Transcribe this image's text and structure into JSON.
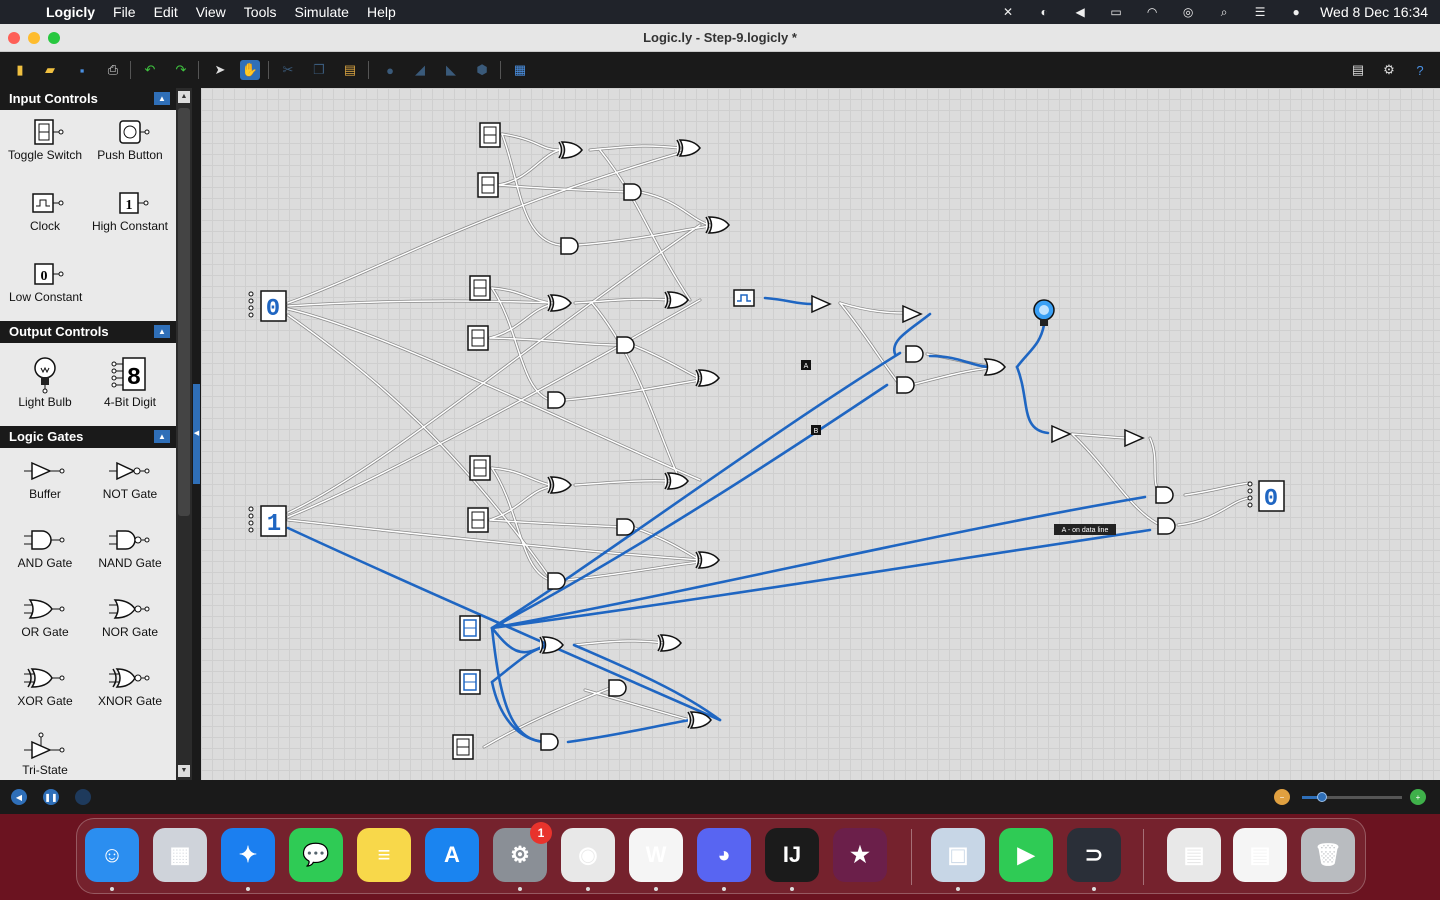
{
  "menubar": {
    "app_name": "Logicly",
    "items": [
      "File",
      "Edit",
      "View",
      "Tools",
      "Simulate",
      "Help"
    ],
    "clock": "Wed 8 Dec  16:34"
  },
  "window": {
    "title": "Logic.ly - Step-9.logicly *"
  },
  "palette": {
    "sections": [
      {
        "title": "Input Controls",
        "items": [
          {
            "label": "Toggle Switch",
            "icon": "toggle-switch-icon"
          },
          {
            "label": "Push Button",
            "icon": "push-button-icon"
          },
          {
            "label": "Clock",
            "icon": "clock-icon"
          },
          {
            "label": "High Constant",
            "icon": "high-constant-icon",
            "glyph": "1"
          },
          {
            "label": "Low Constant",
            "icon": "low-constant-icon",
            "glyph": "0"
          }
        ]
      },
      {
        "title": "Output Controls",
        "items": [
          {
            "label": "Light Bulb",
            "icon": "light-bulb-icon"
          },
          {
            "label": "4-Bit Digit",
            "icon": "four-bit-digit-icon",
            "glyph": "8"
          }
        ]
      },
      {
        "title": "Logic Gates",
        "items": [
          {
            "label": "Buffer",
            "icon": "buffer-gate-icon"
          },
          {
            "label": "NOT Gate",
            "icon": "not-gate-icon"
          },
          {
            "label": "AND Gate",
            "icon": "and-gate-icon"
          },
          {
            "label": "NAND Gate",
            "icon": "nand-gate-icon"
          },
          {
            "label": "OR Gate",
            "icon": "or-gate-icon"
          },
          {
            "label": "NOR Gate",
            "icon": "nor-gate-icon"
          },
          {
            "label": "XOR Gate",
            "icon": "xor-gate-icon"
          },
          {
            "label": "XNOR Gate",
            "icon": "xnor-gate-icon"
          },
          {
            "label": "Tri-State",
            "icon": "tri-state-icon"
          }
        ]
      }
    ]
  },
  "canvas": {
    "digit_left_top": "0",
    "digit_left_bottom": "1",
    "digit_right": "0",
    "label_a": "A",
    "label_b": "B",
    "tooltip": "A - on data line"
  },
  "dock": {
    "apps": [
      {
        "name": "Finder",
        "icon": "finder-icon",
        "color": "#2b8ef0",
        "glyph": "☺",
        "running": true
      },
      {
        "name": "Launchpad",
        "icon": "launchpad-icon",
        "color": "#cfd3da",
        "glyph": "▦",
        "running": false
      },
      {
        "name": "Safari",
        "icon": "safari-icon",
        "color": "#1b7ff0",
        "glyph": "✦",
        "running": true
      },
      {
        "name": "Messages",
        "icon": "messages-icon",
        "color": "#2fcb55",
        "glyph": "💬",
        "running": false
      },
      {
        "name": "Notes",
        "icon": "notes-icon",
        "color": "#f8d84a",
        "glyph": "≡",
        "running": false
      },
      {
        "name": "App Store",
        "icon": "app-store-icon",
        "color": "#1a84f0",
        "glyph": "A",
        "running": false
      },
      {
        "name": "System Preferences",
        "icon": "system-preferences-icon",
        "color": "#8a8f96",
        "glyph": "⚙",
        "running": true,
        "badge": "1"
      },
      {
        "name": "Chrome",
        "icon": "chrome-icon",
        "color": "#e8e8e8",
        "glyph": "◉",
        "running": true
      },
      {
        "name": "Word",
        "icon": "word-icon",
        "color": "#f5f5f5",
        "glyph": "W",
        "running": true
      },
      {
        "name": "Discord",
        "icon": "discord-icon",
        "color": "#5865f2",
        "glyph": "◕",
        "running": true
      },
      {
        "name": "IntelliJ IDEA",
        "icon": "intellij-icon",
        "color": "#1b1b1b",
        "glyph": "IJ",
        "running": true
      },
      {
        "name": "Superstar",
        "icon": "superstar-icon",
        "color": "#6b1f4a",
        "glyph": "★",
        "running": false
      },
      {
        "name": "Preview",
        "icon": "preview-icon",
        "color": "#c7d6e6",
        "glyph": "▣",
        "running": true
      },
      {
        "name": "FaceTime",
        "icon": "facetime-icon",
        "color": "#2fcb55",
        "glyph": "▶",
        "running": false
      },
      {
        "name": "Logicly",
        "icon": "logicly-icon",
        "color": "#2a2f38",
        "glyph": "⊃",
        "running": true
      },
      {
        "name": "Document Folder",
        "icon": "document-stack-icon",
        "color": "#e8e8e8",
        "glyph": "▤",
        "running": false
      },
      {
        "name": "Word Document",
        "icon": "word-document-icon",
        "color": "#f5f5f5",
        "glyph": "▤",
        "running": false
      },
      {
        "name": "Trash",
        "icon": "trash-icon",
        "color": "#b9bcc0",
        "glyph": "🗑",
        "running": false
      }
    ]
  },
  "colors": {
    "active_wire": "#1f66c2",
    "idle_wire": "#ffffff",
    "accent": "#2f6fb8"
  },
  "zoom_level": 0.2
}
